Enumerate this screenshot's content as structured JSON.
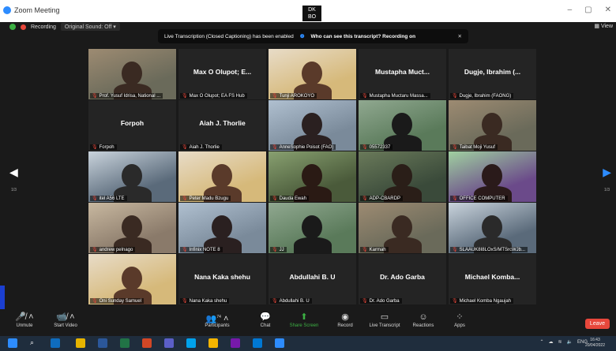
{
  "window": {
    "title": "Zoom Meeting",
    "brand": "DK\nBO"
  },
  "topbar": {
    "recording": "Recording",
    "original_sound": "Original Sound: Off",
    "view": "View"
  },
  "banner": {
    "text": "Live Transcription (Closed Captioning) has been enabled",
    "question": "Who can see this transcript? Recording on"
  },
  "pages": {
    "left": "1/3",
    "right": "1/3"
  },
  "tiles": [
    {
      "label": "Prof. Yusuf Idrisa, National ...",
      "big": "",
      "video": true
    },
    {
      "label": "Max O Olupot; EA FS Hub",
      "big": "Max O Olupot; E...",
      "video": false
    },
    {
      "label": "Tunji AROKOYO",
      "big": "",
      "video": true
    },
    {
      "label": "Mustapha Muctaru Massa...",
      "big": "Mustapha Muct...",
      "video": false
    },
    {
      "label": "Dugje, Ibrahim (FAONG)",
      "big": "Dugje, Ibrahim (...",
      "video": false
    },
    {
      "label": "Forpoh",
      "big": "Forpoh",
      "video": false
    },
    {
      "label": "Aiah J. Thorlie",
      "big": "Aiah J. Thorlie",
      "video": false
    },
    {
      "label": "AnneSophie Poisot (FAO)",
      "big": "",
      "video": true
    },
    {
      "label": "05572337",
      "big": "",
      "video": true
    },
    {
      "label": "Taibat Moji Yusuf",
      "big": "",
      "video": true
    },
    {
      "label": "itel A56 LTE",
      "big": "",
      "video": true
    },
    {
      "label": "Peter Madu Bzugu",
      "big": "",
      "video": true
    },
    {
      "label": "Dauda Ewah",
      "big": "",
      "video": true
    },
    {
      "label": "ADP-CBARDP",
      "big": "",
      "video": true
    },
    {
      "label": "OFFICE COMPUTER",
      "big": "",
      "video": true
    },
    {
      "label": "andrew pelnago",
      "big": "",
      "video": true
    },
    {
      "label": "Infinix NOTE 8",
      "big": "",
      "video": true
    },
    {
      "label": "JJ",
      "big": "",
      "video": true
    },
    {
      "label": "Karmah",
      "big": "",
      "video": true
    },
    {
      "label": "SLAAUK8I8LOxS/MTSrcWJb...",
      "big": "",
      "video": true
    },
    {
      "label": "Oni Sunday Samuel",
      "big": "",
      "video": true
    },
    {
      "label": "Nana Kaka shehu",
      "big": "Nana Kaka shehu",
      "video": false
    },
    {
      "label": "Abdullahi B. U",
      "big": "Abdullahi B. U",
      "video": false
    },
    {
      "label": "Dr. Ado Garba",
      "big": "Dr. Ado Garba",
      "video": false
    },
    {
      "label": "Michael Komba Ngaujah",
      "big": "Michael Komba...",
      "video": false
    }
  ],
  "toolbar": {
    "unmute": "Unmute",
    "start_video": "Start Video",
    "participants": "Participants",
    "participants_count": "74",
    "chat": "Chat",
    "share_screen": "Share Screen",
    "record": "Record",
    "live_transcript": "Live Transcript",
    "reactions": "Reactions",
    "apps": "Apps",
    "leave": "Leave"
  },
  "taskbar": {
    "lang": "ENG",
    "time": "16:43",
    "date": "20/04/2022"
  },
  "colors": {
    "accent": "#2d8cff",
    "leave": "#e8473b",
    "green": "#3cb043",
    "active_speaker": "#f0d74a"
  }
}
